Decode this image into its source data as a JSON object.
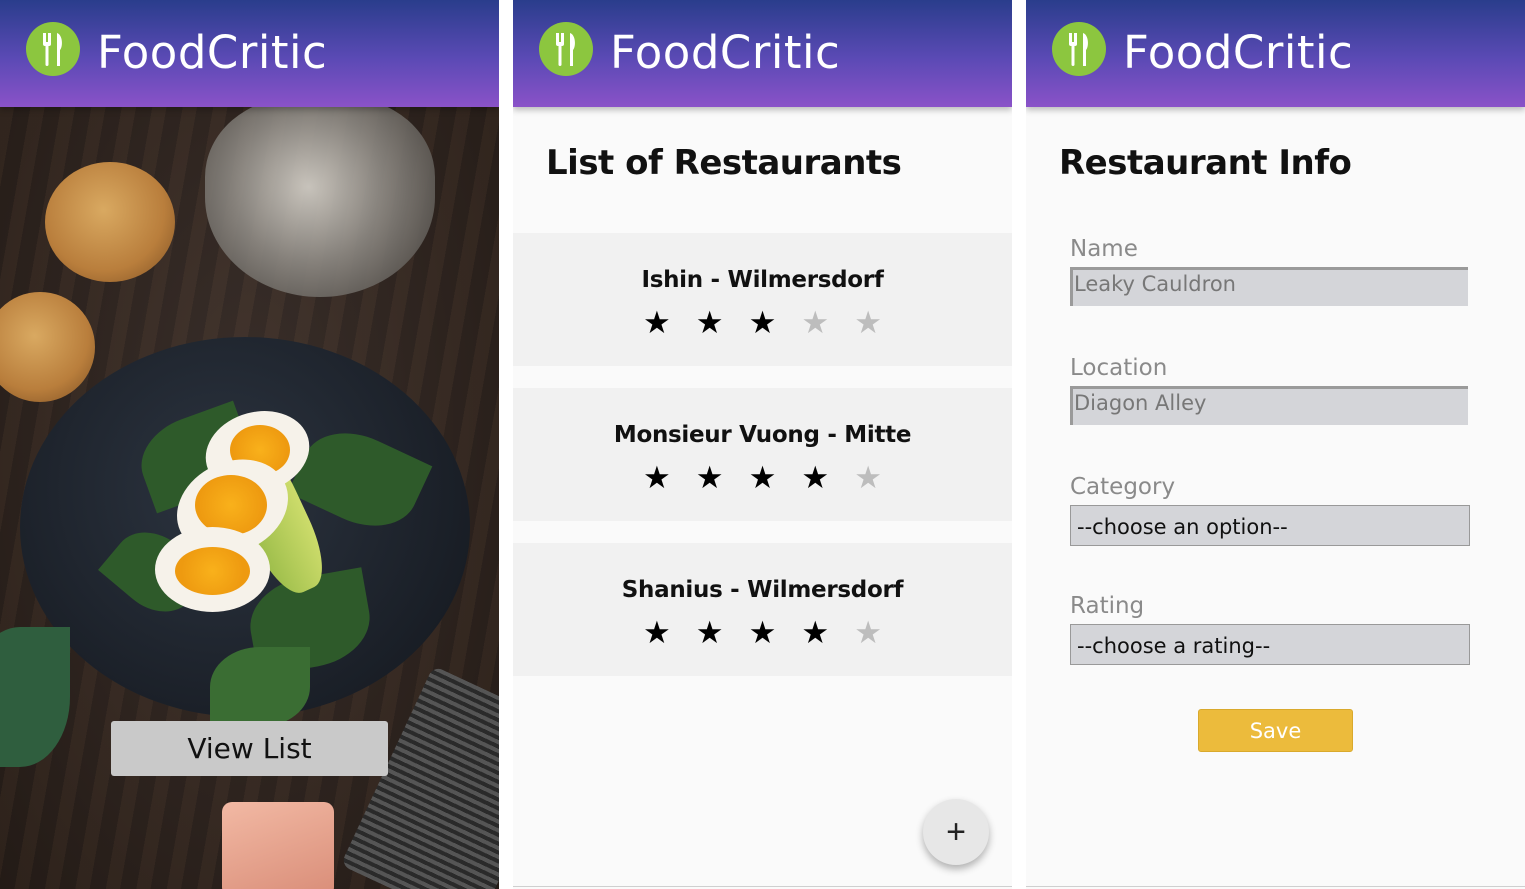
{
  "app": {
    "name": "FoodCritic",
    "brand_gradient": [
      "#2a3d8c",
      "#8a52c8"
    ],
    "logo_color": "#8cc63f",
    "logo_icon": "fork-knife-icon"
  },
  "home": {
    "view_list_label": "View List"
  },
  "list": {
    "title": "List of Restaurants",
    "restaurants": [
      {
        "name": "Ishin - Wilmersdorf",
        "rating": 3,
        "max": 5
      },
      {
        "name": "Monsieur Vuong - Mitte",
        "rating": 4,
        "max": 5
      },
      {
        "name": "Shanius - Wilmersdorf",
        "rating": 4,
        "max": 5
      }
    ],
    "fab_label": "+"
  },
  "form": {
    "title": "Restaurant Info",
    "name_label": "Name",
    "name_placeholder": "Leaky Cauldron",
    "location_label": "Location",
    "location_placeholder": "Diagon Alley",
    "category_label": "Category",
    "category_value": "--choose an option--",
    "rating_label": "Rating",
    "rating_value": "--choose a rating--",
    "save_label": "Save",
    "save_color": "#ecbb3c"
  }
}
